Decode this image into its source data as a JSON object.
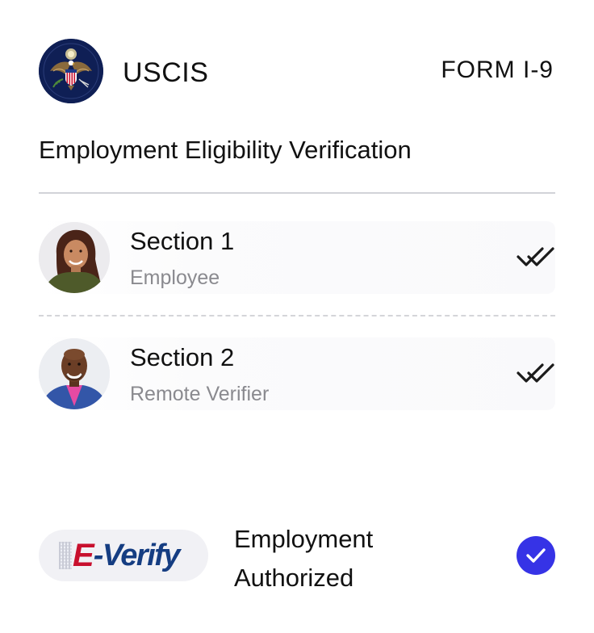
{
  "header": {
    "agency": "USCIS",
    "form_id": "FORM I-9",
    "seal_icon": "great-seal-eagle-icon",
    "seal_color": "#0f1f55"
  },
  "form": {
    "title": "Employment Eligibility Verification"
  },
  "sections": [
    {
      "title": "Section 1",
      "subtitle": "Employee",
      "status_icon": "double-check-icon"
    },
    {
      "title": "Section 2",
      "subtitle": "Remote Verifier",
      "status_icon": "double-check-icon"
    }
  ],
  "everify": {
    "logo_e": "E",
    "logo_verify": "-Verify",
    "logo_e_color": "#c8102e",
    "logo_verify_color": "#153d82",
    "status_line1": "Employment",
    "status_line2": "Authorized",
    "status_icon": "check-circle-icon",
    "accent_color": "#3633e6"
  }
}
